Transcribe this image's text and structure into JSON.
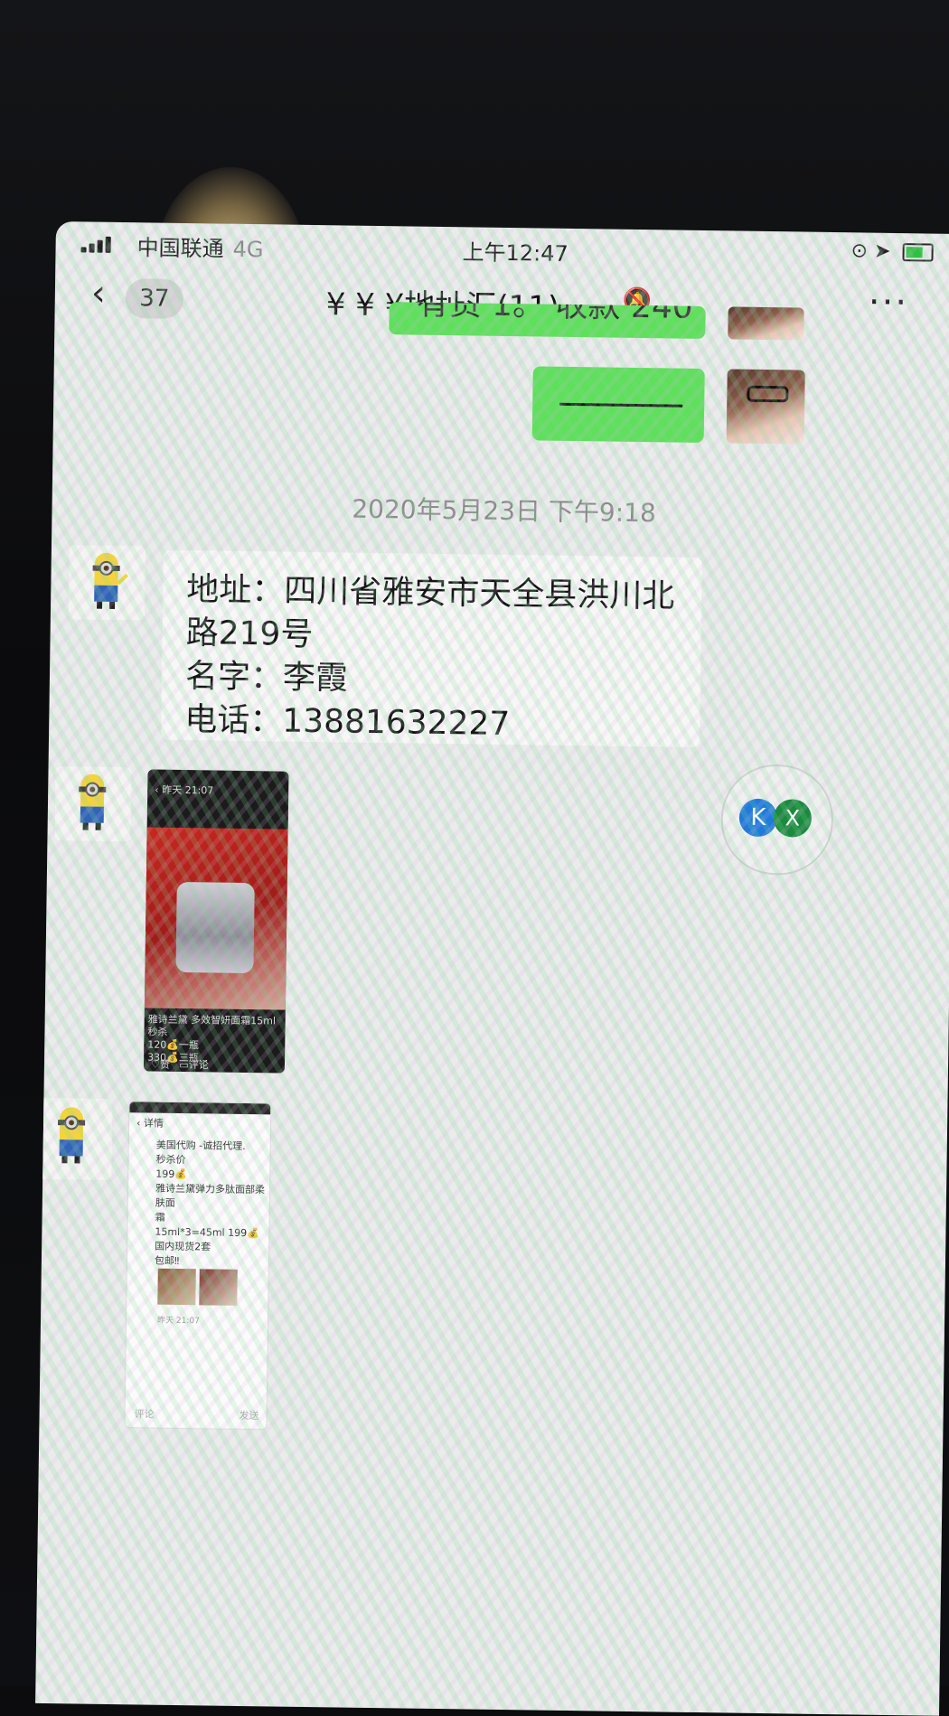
{
  "status_bar": {
    "carrier": "中国联通",
    "network": "4G",
    "time": "上午12:47"
  },
  "nav": {
    "back_count": "37",
    "title": "¥ ¥ ¥地址汇(11)"
  },
  "messages": {
    "partial_green": "有货 1。 收款 240",
    "dash_message": "———",
    "timestamp": "2020年5月23日 下午9:18",
    "address_lines": [
      "地址：四川省雅安市天全县洪川北",
      "路219号",
      "名字：李霞",
      "电话：13881632227"
    ]
  },
  "thumb1": {
    "header": "昨天 21:07",
    "caption": "雅诗兰黛 多效智妍面霜15ml",
    "line1": "秒杀",
    "line2": "120💰一瓶",
    "line3": "330💰三瓶...",
    "like": "赞",
    "comment": "评论"
  },
  "thumb2": {
    "header": "详情",
    "lines": [
      "美国代购 -诚招代理.",
      "秒杀价",
      "199💰",
      "雅诗兰黛弹力多肽面部柔肤面",
      "霜",
      "15ml*3=45ml 199💰",
      "国内现货2套",
      "包邮‼"
    ],
    "time": "昨天 21:07",
    "comment_placeholder": "评论",
    "send": "发送"
  },
  "floating": {
    "k_label": "K",
    "x_label": "X"
  }
}
